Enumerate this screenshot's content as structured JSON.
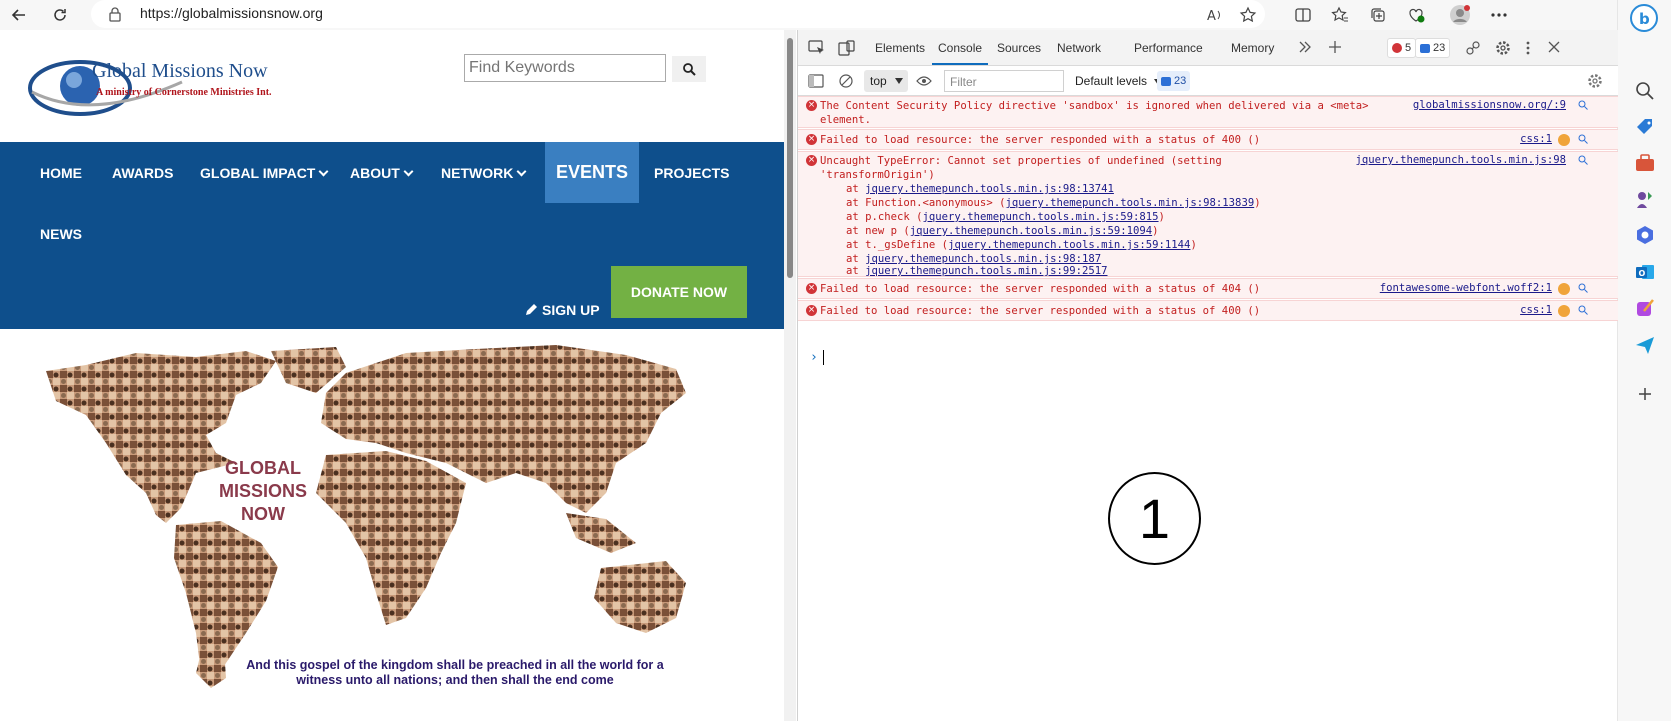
{
  "browser": {
    "url": "https://globalmissionsnow.org",
    "icons": [
      "back-arrow-icon",
      "refresh-icon",
      "lock-icon",
      "read-aloud-icon",
      "favorite-star-icon",
      "split-screen-icon",
      "favorites-icon",
      "collections-icon",
      "browser-essentials-icon",
      "profile-avatar-icon",
      "more-icon"
    ]
  },
  "sidebar": {
    "icons": [
      "bing-icon",
      "search-icon",
      "shopping-tag-icon",
      "toolbox-icon",
      "games-icon",
      "microsoft365-icon",
      "outlook-icon",
      "designer-icon",
      "send-icon",
      "add-icon"
    ]
  },
  "site": {
    "logo_name": "Global Missions Now",
    "logo_tagline": "A ministry of Cornerstone Ministries Int.",
    "search_placeholder": "Find Keywords",
    "nav": {
      "home": "HOME",
      "awards": "AWARDS",
      "global_impact": "GLOBAL IMPACT",
      "about": "ABOUT",
      "network": "NETWORK",
      "events": "EVENTS",
      "projects": "PROJECTS",
      "news": "NEWS"
    },
    "signup": "SIGN UP",
    "donate": "DONATE NOW",
    "map_title": "GLOBAL MISSIONS NOW",
    "verse": "And this gospel of the kingdom shall be preached in all the world for a witness unto all nations; and then shall the end come"
  },
  "devtools": {
    "tabs": {
      "elements": "Elements",
      "console": "Console",
      "sources": "Sources",
      "network": "Network",
      "performance": "Performance",
      "memory": "Memory"
    },
    "error_count": "5",
    "message_count": "23",
    "context": "top",
    "filter_placeholder": "Filter",
    "levels": "Default levels",
    "toolbar_message_count": "23",
    "messages": {
      "m1_text": "The Content Security Policy directive 'sandbox' is ignored when delivered via a <meta>\nelement.",
      "m1_src": "globalmissionsnow.org/:9",
      "m2_text": "Failed to load resource: the server responded with a status of 400 ()",
      "m2_src": "css:1",
      "m3_text": "Uncaught TypeError: Cannot set properties of undefined (setting\n'transformOrigin')",
      "m3_src": "jquery.themepunch.tools.min.js:98",
      "m4_text": "Failed to load resource: the server responded with a status of 404 ()",
      "m4_src": "fontawesome-webfont.woff2:1",
      "m5_text": "Failed to load resource: the server responded with a status of 400 ()",
      "m5_src": "css:1"
    },
    "stack": [
      {
        "prefix": "at ",
        "link": "jquery.themepunch.tools.min.js:98:13741",
        "suffix": ""
      },
      {
        "prefix": "at Function.<anonymous> (",
        "link": "jquery.themepunch.tools.min.js:98:13839",
        "suffix": ")"
      },
      {
        "prefix": "at p.check (",
        "link": "jquery.themepunch.tools.min.js:59:815",
        "suffix": ")"
      },
      {
        "prefix": "at new p (",
        "link": "jquery.themepunch.tools.min.js:59:1094",
        "suffix": ")"
      },
      {
        "prefix": "at t._gsDefine (",
        "link": "jquery.themepunch.tools.min.js:59:1144",
        "suffix": ")"
      },
      {
        "prefix": "at ",
        "link": "jquery.themepunch.tools.min.js:98:187",
        "suffix": ""
      },
      {
        "prefix": "at ",
        "link": "jquery.themepunch.tools.min.js:99:2517",
        "suffix": ""
      }
    ],
    "prompt": "›"
  },
  "annotation": {
    "label": "1"
  },
  "colors": {
    "nav_blue": "#0e4f8c",
    "events_blue": "#3a7fc1",
    "donate_green": "#73b144",
    "error_red": "#c21e1e",
    "error_bg": "#fdf2f2"
  }
}
